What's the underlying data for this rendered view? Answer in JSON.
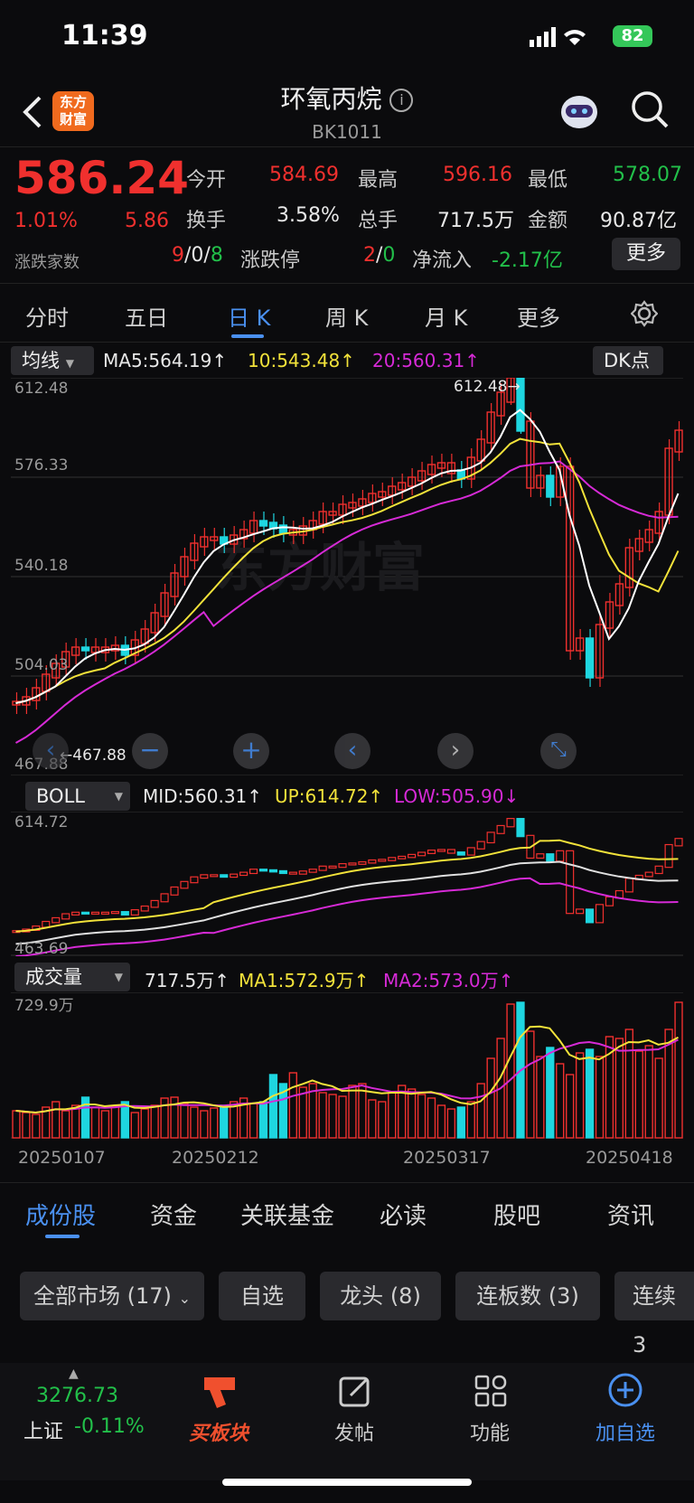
{
  "status": {
    "time": "11:39",
    "battery": "82"
  },
  "header": {
    "title": "环氧丙烷",
    "code": "BK1011",
    "logo_line1": "东方",
    "logo_line2": "财富"
  },
  "quote": {
    "price": "586.24",
    "pct": "1.01%",
    "change": "5.86",
    "open_label": "今开",
    "open": "584.69",
    "high_label": "最高",
    "high": "596.16",
    "low_label": "最低",
    "low": "578.07",
    "turnover_label": "换手",
    "turnover": "3.58%",
    "volume_label": "总手",
    "volume": "717.5万",
    "amount_label": "金额",
    "amount": "90.87亿",
    "breadth_label": "涨跌家数",
    "breadth_up": "9",
    "breadth_flat": "0",
    "breadth_down": "8",
    "limit_label": "涨跌停",
    "limit_up": "2",
    "limit_down": "0",
    "netflow_label": "净流入",
    "netflow": "-2.17亿",
    "more_label": "更多"
  },
  "period_tabs": [
    {
      "label": "分时"
    },
    {
      "label": "五日"
    },
    {
      "label": "日 K"
    },
    {
      "label": "周 K"
    },
    {
      "label": "月 K"
    },
    {
      "label": "更多"
    }
  ],
  "ma_bar": {
    "selector": "均线",
    "ma5": "MA5:564.19",
    "ma10": "10:543.48",
    "ma20": "20:560.31",
    "dk": "DK点"
  },
  "boll_bar": {
    "selector": "BOLL",
    "mid": "MID:560.31",
    "up": "UP:614.72",
    "low": "LOW:505.90"
  },
  "vol_bar": {
    "selector": "成交量",
    "vol": "717.5万",
    "ma1": "MA1:572.9万",
    "ma2": "MA2:573.0万"
  },
  "chart_data": [
    {
      "type": "candlestick",
      "title": "日K",
      "y_ticks": [
        "612.48",
        "576.33",
        "540.18",
        "504.03",
        "467.88"
      ],
      "annotations": [
        "612.48",
        "467.88"
      ],
      "ylim": [
        467.88,
        612.48
      ]
    },
    {
      "type": "line",
      "title": "BOLL",
      "y_ticks": [
        "614.72",
        "463.69"
      ]
    },
    {
      "type": "bar",
      "title": "成交量",
      "y_ticks": [
        "729.9万"
      ],
      "x_ticks": [
        "20250107",
        "20250212",
        "20250317",
        "20250418"
      ]
    }
  ],
  "bottom_tabs": [
    {
      "label": "成份股"
    },
    {
      "label": "资金"
    },
    {
      "label": "关联基金"
    },
    {
      "label": "必读"
    },
    {
      "label": "股吧"
    },
    {
      "label": "资讯"
    }
  ],
  "filters": [
    {
      "label": "全部市场 (17)"
    },
    {
      "label": "自选"
    },
    {
      "label": "龙头 (8)"
    },
    {
      "label": "连板数 (3)"
    },
    {
      "label": "连续 3"
    }
  ],
  "nav": {
    "index_value": "3276.73",
    "index_name": "上证",
    "index_pct": "-0.11%",
    "buy": "买板块",
    "post": "发帖",
    "func": "功能",
    "add": "加自选"
  },
  "colors": {
    "up": "#f0302e",
    "down": "#22c04a",
    "cyan": "#1ed6e0",
    "ma5": "#ffffff",
    "ma10": "#f2e23a",
    "ma20": "#d62ad6",
    "accent": "#4a90f0"
  }
}
